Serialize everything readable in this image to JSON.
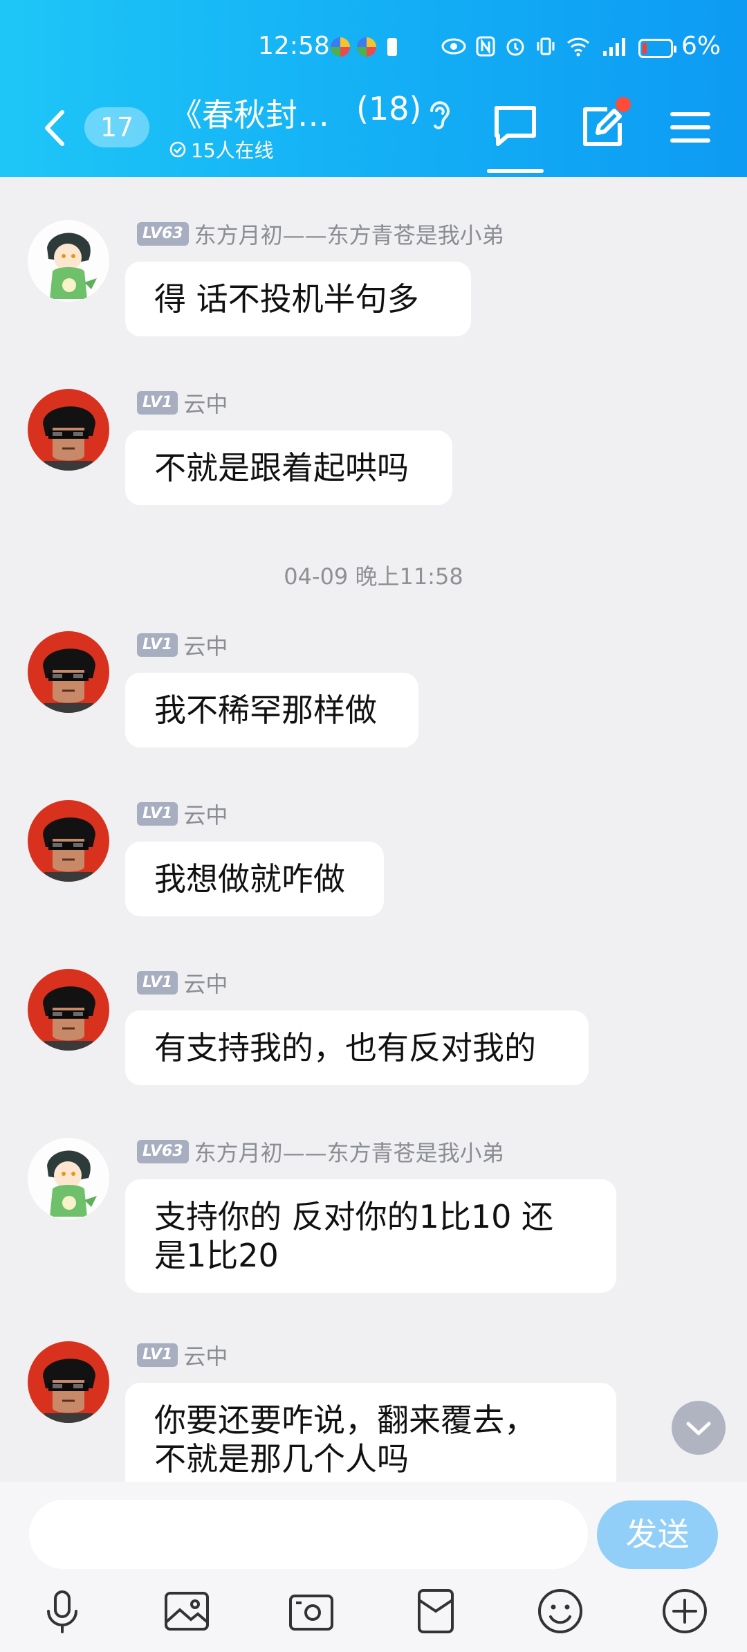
{
  "status_bar": {
    "time": "12:58",
    "battery": "6%"
  },
  "header": {
    "unread_count": "17",
    "group_name": "《春秋封…",
    "member_count": "(18)",
    "online_text": "15人在线"
  },
  "messages": [
    {
      "level": "LV63",
      "nickname": "东方月初——东方青苍是我小弟",
      "text": "得  话不投机半句多",
      "avatar": "dragon-girl"
    },
    {
      "level": "LV1",
      "nickname": "云中",
      "text": "不就是跟着起哄吗",
      "avatar": "sunglasses-man"
    },
    {
      "level": "LV1",
      "nickname": "云中",
      "text": "我不稀罕那样做",
      "avatar": "sunglasses-man"
    },
    {
      "level": "LV1",
      "nickname": "云中",
      "text": "我想做就咋做",
      "avatar": "sunglasses-man"
    },
    {
      "level": "LV1",
      "nickname": "云中",
      "text": "有支持我的，也有反对我的",
      "avatar": "sunglasses-man"
    },
    {
      "level": "LV63",
      "nickname": "东方月初——东方青苍是我小弟",
      "text_lines": [
        "支持你的  反对你的1比10  还",
        "是1比20"
      ],
      "avatar": "dragon-girl"
    },
    {
      "level": "LV1",
      "nickname": "云中",
      "text_lines": [
        "你要还要咋说，翻来覆去，",
        "不就是那几个人吗"
      ],
      "avatar": "sunglasses-man"
    }
  ],
  "time_separator": "04-09 晚上11:58",
  "composer": {
    "send_label": "发送"
  },
  "toolbar": [
    "microphone-icon",
    "image-icon",
    "camera-icon",
    "red-packet-icon",
    "emoji-icon",
    "plus-icon"
  ]
}
